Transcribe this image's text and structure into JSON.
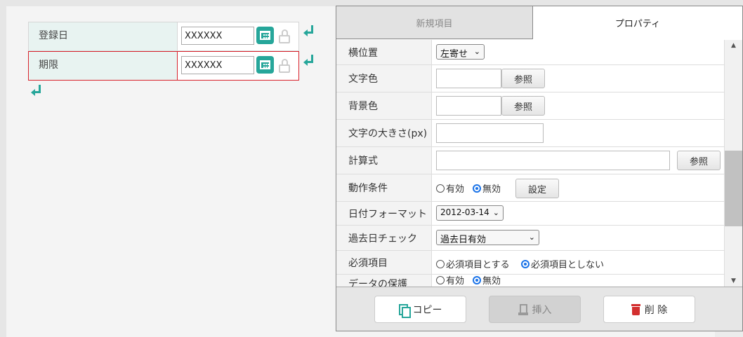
{
  "form": {
    "rows": [
      {
        "label": "登録日",
        "value": "XXXXXX"
      },
      {
        "label": "期限",
        "value": "XXXXXX"
      }
    ]
  },
  "tabs": [
    {
      "label": "新規項目",
      "active": false
    },
    {
      "label": "プロパティ",
      "active": true
    }
  ],
  "properties": {
    "h_position": {
      "label": "横位置",
      "value": "左寄せ"
    },
    "text_color": {
      "label": "文字色",
      "value": "",
      "button": "参照"
    },
    "bg_color": {
      "label": "背景色",
      "value": "",
      "button": "参照"
    },
    "font_size": {
      "label": "文字の大きさ(px)",
      "value": ""
    },
    "formula": {
      "label": "計算式",
      "value": "",
      "button": "参照"
    },
    "condition": {
      "label": "動作条件",
      "option_on": "有効",
      "option_off": "無効",
      "selected": "無効",
      "button": "設定"
    },
    "date_format": {
      "label": "日付フォーマット",
      "value": "2012-03-14"
    },
    "past_check": {
      "label": "過去日チェック",
      "value": "過去日有効"
    },
    "required": {
      "label": "必須項目",
      "option_on": "必須項目とする",
      "option_off": "必須項目としない",
      "selected": "必須項目としない"
    },
    "protect": {
      "label": "データの保護",
      "option_on": "有効",
      "option_off": "無効"
    }
  },
  "footer": {
    "copy": "コピー",
    "insert": "挿入",
    "delete": "削 除"
  },
  "colors": {
    "accent": "#26a69a",
    "selected_border": "#d9232d",
    "delete": "#d32f2f"
  }
}
